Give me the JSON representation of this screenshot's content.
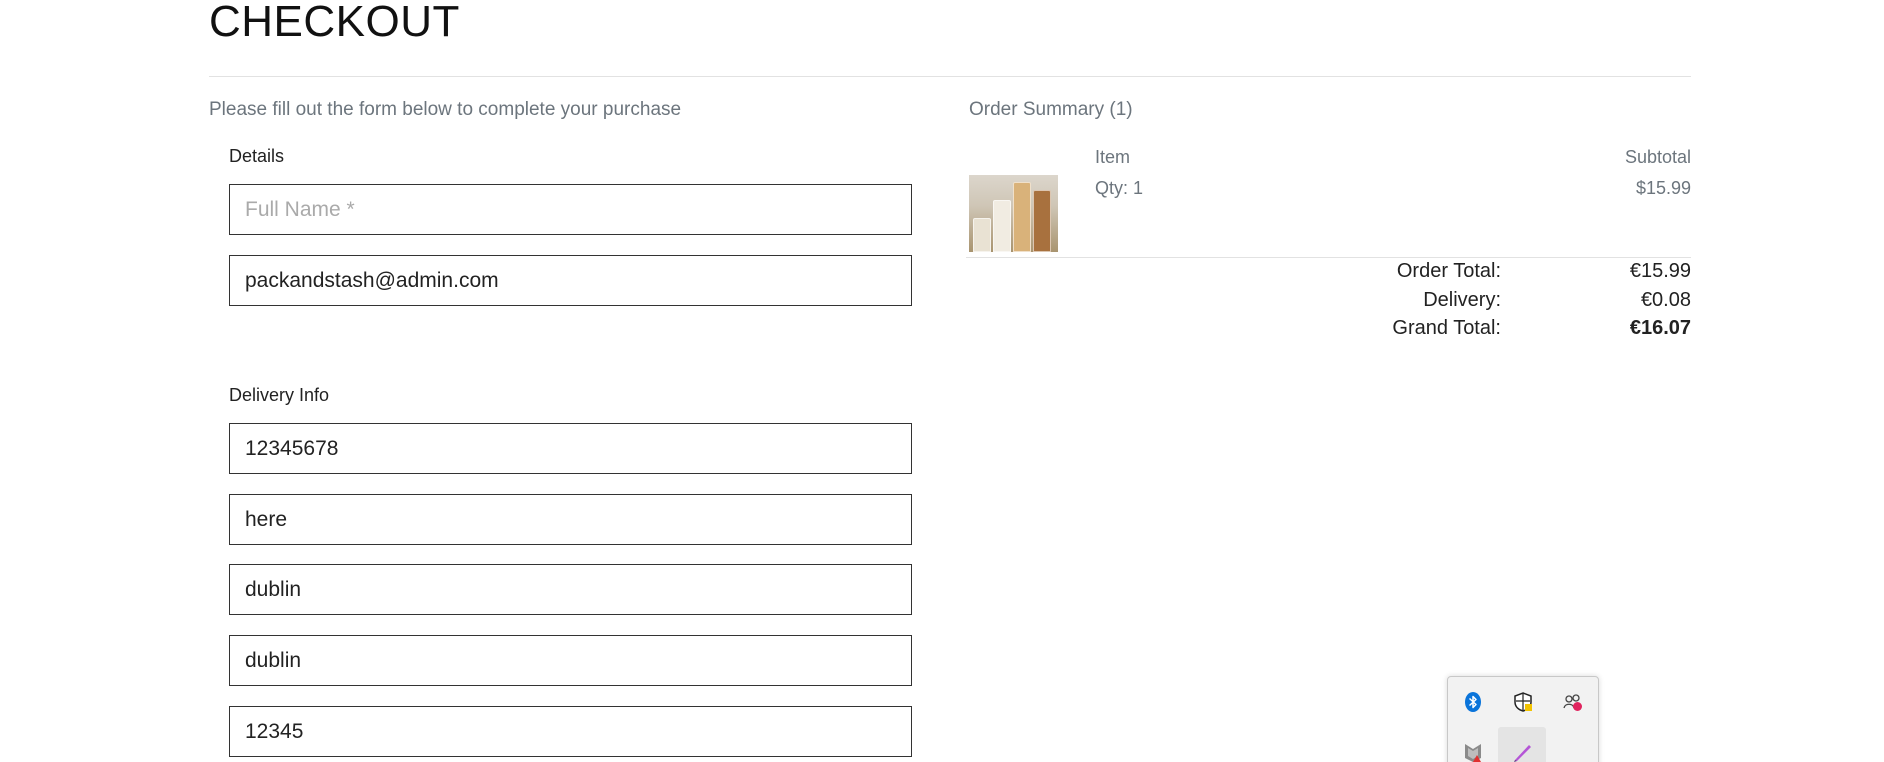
{
  "page": {
    "title": "CHECKOUT",
    "subtitle": "Please fill out the form below to complete your purchase"
  },
  "form": {
    "details_label": "Details",
    "full_name": {
      "value": "",
      "placeholder": "Full Name *"
    },
    "email": {
      "value": "packandstash@admin.com",
      "placeholder": ""
    },
    "delivery_label": "Delivery Info",
    "phone": {
      "value": "12345678"
    },
    "address": {
      "value": "here"
    },
    "town": {
      "value": "dublin"
    },
    "county": {
      "value": "dublin"
    },
    "postcode": {
      "value": "12345"
    }
  },
  "summary": {
    "title": "Order Summary (1)",
    "col_item": "Item",
    "col_subtotal": "Subtotal",
    "items": [
      {
        "image": "storage-jars-product-image",
        "qty": "Qty: 1",
        "subtotal": "$15.99"
      }
    ],
    "order_total_label": "Order Total:",
    "order_total_value": "€15.99",
    "delivery_label": "Delivery:",
    "delivery_value": "€0.08",
    "grand_total_label": "Grand Total:",
    "grand_total_value": "€16.07"
  },
  "system_tray": {
    "icons": [
      "bluetooth-icon",
      "security-shield-icon",
      "meet-now-icon",
      "mcafee-icon",
      "onenote-pen-icon"
    ]
  },
  "colors": {
    "muted_text": "#6c757d",
    "input_border": "#333333",
    "rule": "#e2e2e2"
  }
}
